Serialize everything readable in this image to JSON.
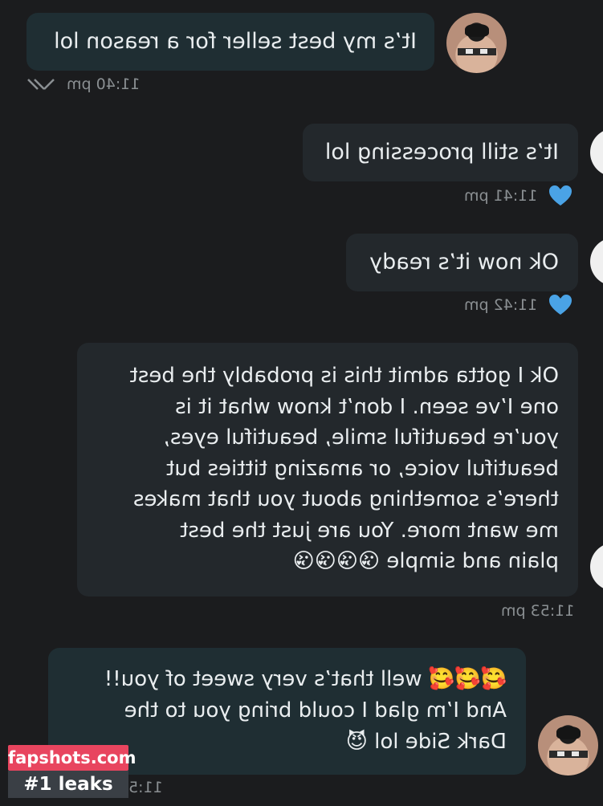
{
  "messages": [
    {
      "id": "m1",
      "text": "It’s my best seller for a reason lol",
      "time": "11:40 pm"
    },
    {
      "id": "m2",
      "text": "It’s still processing lol",
      "time": "11:41 pm"
    },
    {
      "id": "m3",
      "text": "Ok now it’s ready",
      "time": "11:42 pm"
    },
    {
      "id": "m4",
      "text": "Ok I gotta admit this is probably the best\none I’ve seen. I don’t know what it is\nyou’re beautiful smile, beautiful eyes,\nbeautiful voice, or amazing titties but\nthere’s something about you that makes\nme want more. You are just the best\nplain and simple 😘😘😘😘",
      "time": "11:53 pm"
    },
    {
      "id": "m5",
      "text": "🥰🥰🥰 well that’s very sweet of you!!\nAnd I’m glad I could bring you to the\nDark Side lol 😈",
      "time": "11:5"
    }
  ],
  "icons": {
    "read_receipt": "double-check-icon",
    "liked": "heart-icon",
    "heart_color": "#4aa3e6"
  },
  "watermark": {
    "line1": "fapshots.com",
    "line2": "#1 leaks",
    "accent": "#e8455f"
  }
}
